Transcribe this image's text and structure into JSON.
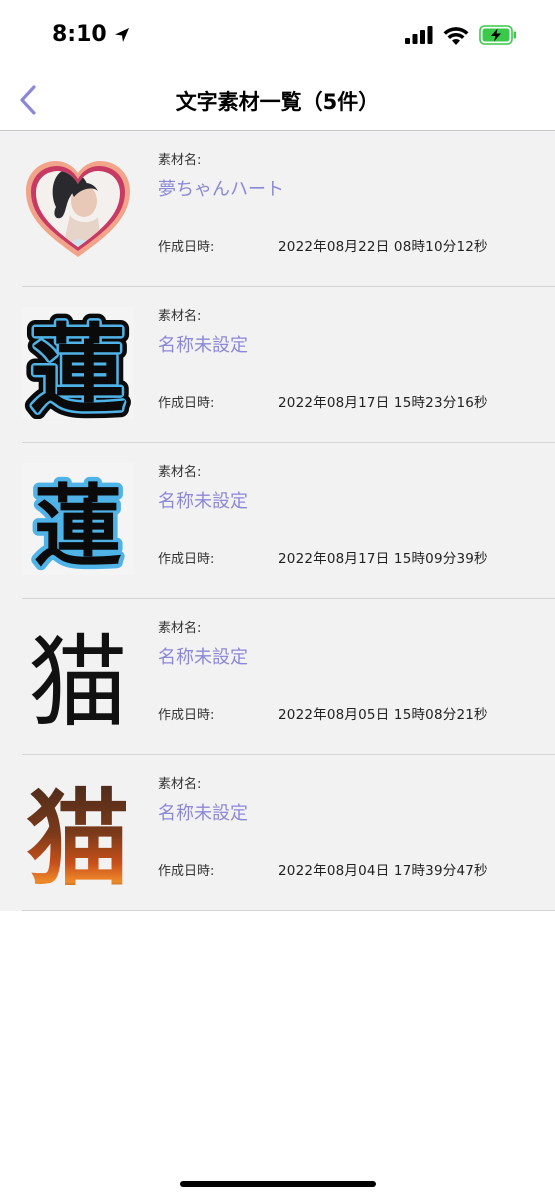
{
  "status_bar": {
    "time": "8:10"
  },
  "nav": {
    "title": "文字素材一覧（5件）"
  },
  "labels": {
    "name": "素材名:",
    "created": "作成日時:"
  },
  "items": [
    {
      "name": "夢ちゃんハート",
      "created": "2022年08月22日 08時10分12秒",
      "thumb_kind": "heart-photo",
      "thumb_text": ""
    },
    {
      "name": "名称未設定",
      "created": "2022年08月17日 15時23分16秒",
      "thumb_kind": "kanji-outlined-blue",
      "thumb_text": "蓮"
    },
    {
      "name": "名称未設定",
      "created": "2022年08月17日 15時09分39秒",
      "thumb_kind": "kanji-outlined-blue-light",
      "thumb_text": "蓮"
    },
    {
      "name": "名称未設定",
      "created": "2022年08月05日 15時08分21秒",
      "thumb_kind": "kanji-plain",
      "thumb_text": "猫"
    },
    {
      "name": "名称未設定",
      "created": "2022年08月04日 17時39分47秒",
      "thumb_kind": "kanji-fire",
      "thumb_text": "猫"
    }
  ],
  "colors": {
    "accent": "#8c88d8",
    "list_bg": "#f2f2f2",
    "kanji_blue": "#4fb3e8",
    "kanji_outline": "#0a0a0a",
    "heart_outer": "#f2a48a",
    "heart_inner": "#c73a63"
  }
}
